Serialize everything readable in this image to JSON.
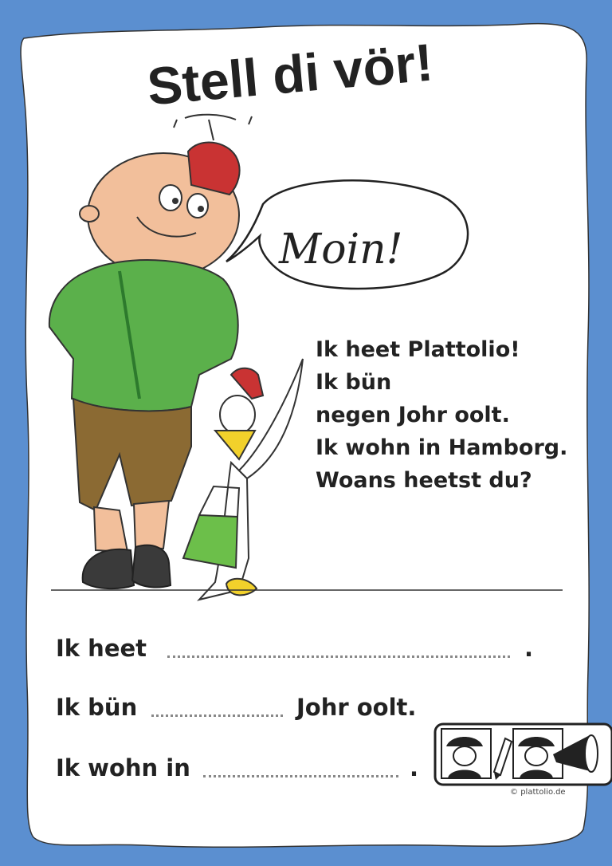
{
  "title": "Stell di vör!",
  "greeting": "Moin!",
  "intro_lines": [
    "Ik heet Plattolio!",
    "Ik bün",
    "negen Johr oolt.",
    "Ik wohn in Hamborg.",
    "Woans heetst du?"
  ],
  "form": {
    "row1_label": "Ik heet",
    "row1_end": ".",
    "row2_label": "Ik bün",
    "row2_suffix": "Johr oolt.",
    "row3_label": "Ik wohn in",
    "row3_end": "."
  },
  "copyright": "plattolio.de",
  "colors": {
    "frame": "#5b8fd0",
    "paper": "#ffffff",
    "jacket": "#5bb04b",
    "shorts": "#8b6a33",
    "cap": "#c93333",
    "skin": "#f2bf9b",
    "bag": "#6cbf4a",
    "beak": "#f2d12b"
  },
  "icons": [
    "boy-cap-icon",
    "pencil-icon",
    "listening-boy-icon",
    "megaphone-icon"
  ]
}
